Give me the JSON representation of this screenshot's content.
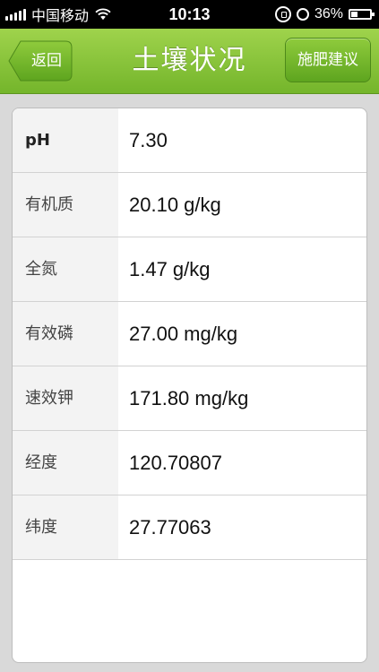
{
  "status_bar": {
    "carrier": "中国移动",
    "time": "10:13",
    "battery_percent": "36%",
    "battery_level": 0.36,
    "icons": [
      "signal-icon",
      "wifi-icon",
      "orientation-lock-icon",
      "alarm-icon",
      "battery-icon"
    ]
  },
  "nav": {
    "back_label": "返回",
    "title": "土壤状况",
    "right_label": "施肥建议"
  },
  "rows": [
    {
      "label": "pH",
      "value": "7.30"
    },
    {
      "label": "有机质",
      "value": "20.10 g/kg"
    },
    {
      "label": "全氮",
      "value": "1.47 g/kg"
    },
    {
      "label": "有效磷",
      "value": "27.00 mg/kg"
    },
    {
      "label": "速效钾",
      "value": "171.80 mg/kg"
    },
    {
      "label": "经度",
      "value": "120.70807"
    },
    {
      "label": "纬度",
      "value": "27.77063"
    }
  ],
  "colors": {
    "nav_green": "#8cc63f",
    "label_bg": "#f3f3f3"
  }
}
